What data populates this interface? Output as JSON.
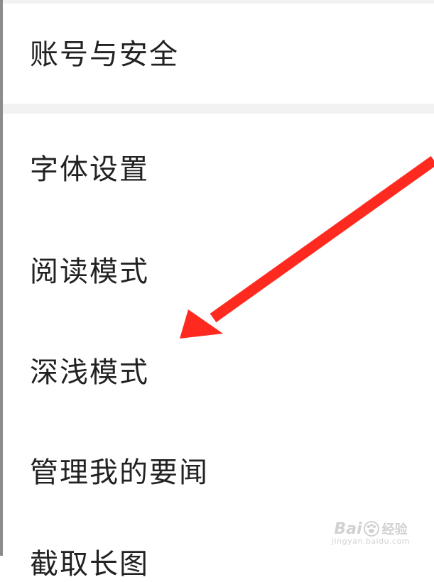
{
  "settings": {
    "items": [
      {
        "id": "account",
        "label": "账号与安全"
      },
      {
        "id": "font",
        "label": "字体设置"
      },
      {
        "id": "reading",
        "label": "阅读模式"
      },
      {
        "id": "dark",
        "label": "深浅模式"
      },
      {
        "id": "news",
        "label": "管理我的要闻"
      },
      {
        "id": "partial",
        "label": "截取长图"
      }
    ]
  },
  "annotation": {
    "arrow_color": "#ff2a1f",
    "target": "深浅模式"
  },
  "watermark": {
    "brand": "Bai",
    "brand_suffix": "经验",
    "domain": "jingyan.baidu.com"
  },
  "colors": {
    "background": "#ffffff",
    "divider": "#f2f2f2",
    "text": "#222222"
  }
}
